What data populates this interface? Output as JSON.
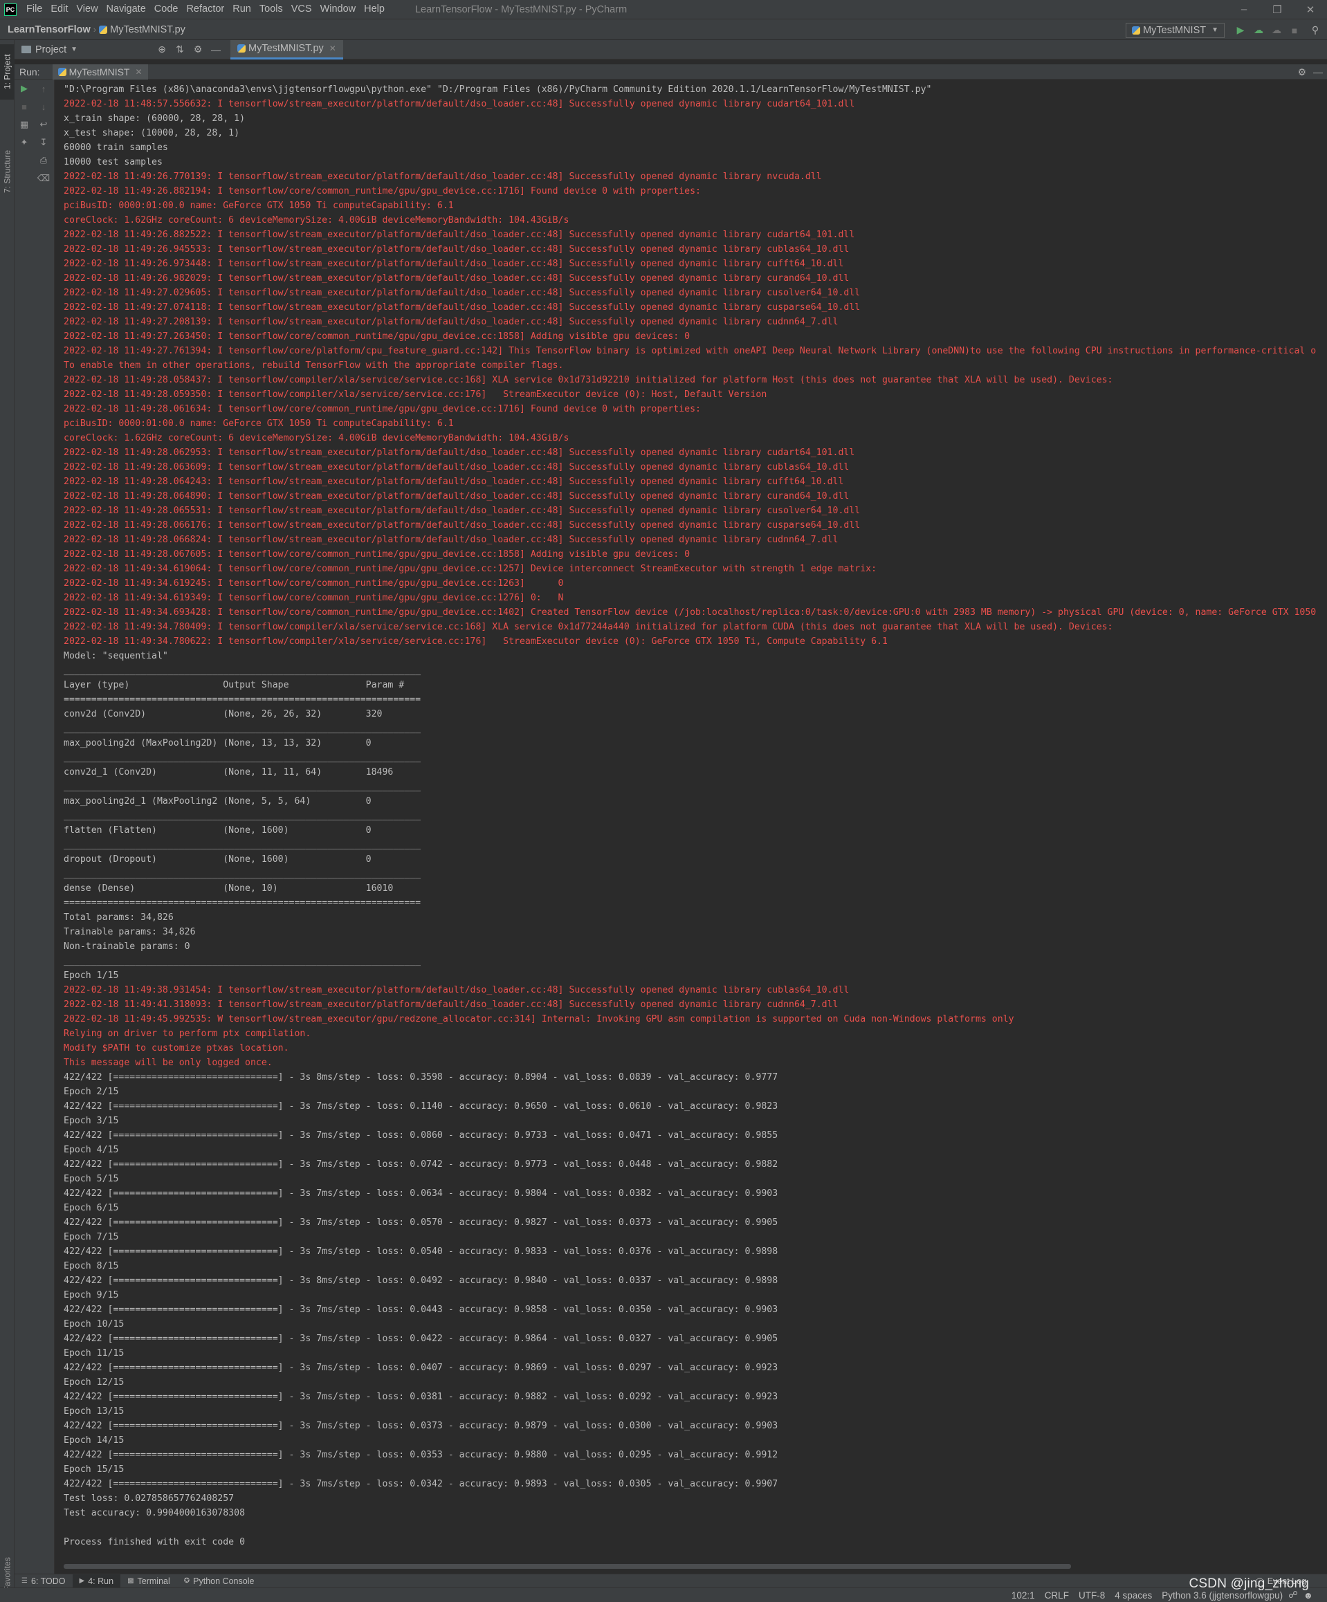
{
  "menubar": {
    "items": [
      "File",
      "Edit",
      "View",
      "Navigate",
      "Code",
      "Refactor",
      "Run",
      "Tools",
      "VCS",
      "Window",
      "Help"
    ],
    "window_title": "LearnTensorFlow - MyTestMNIST.py - PyCharm"
  },
  "navbar": {
    "project": "LearnTensorFlow",
    "file": "MyTestMNIST.py",
    "run_config": "MyTestMNIST"
  },
  "left_stripe": {
    "project_tab": "1: Project",
    "structure_tab": "7: Structure",
    "favorites_tab": "2: Favorites"
  },
  "tool_header": {
    "project_label": "Project",
    "editor_tab": "MyTestMNIST.py"
  },
  "run_window": {
    "label": "Run:",
    "tab": "MyTestMNIST"
  },
  "console": {
    "lines": [
      {
        "t": "\"D:\\Program Files (x86)\\anaconda3\\envs\\jjgtensorflowgpu\\python.exe\" \"D:/Program Files (x86)/PyCharm Community Edition 2020.1.1/LearnTensorFlow/MyTestMNIST.py\"",
        "c": "out"
      },
      {
        "t": "2022-02-18 11:48:57.556632: I tensorflow/stream_executor/platform/default/dso_loader.cc:48] Successfully opened dynamic library cudart64_101.dll",
        "c": "err"
      },
      {
        "t": "x_train shape: (60000, 28, 28, 1)",
        "c": "out"
      },
      {
        "t": "x_test shape: (10000, 28, 28, 1)",
        "c": "out"
      },
      {
        "t": "60000 train samples",
        "c": "out"
      },
      {
        "t": "10000 test samples",
        "c": "out"
      },
      {
        "t": "2022-02-18 11:49:26.770139: I tensorflow/stream_executor/platform/default/dso_loader.cc:48] Successfully opened dynamic library nvcuda.dll",
        "c": "err"
      },
      {
        "t": "2022-02-18 11:49:26.882194: I tensorflow/core/common_runtime/gpu/gpu_device.cc:1716] Found device 0 with properties:",
        "c": "err"
      },
      {
        "t": "pciBusID: 0000:01:00.0 name: GeForce GTX 1050 Ti computeCapability: 6.1",
        "c": "err"
      },
      {
        "t": "coreClock: 1.62GHz coreCount: 6 deviceMemorySize: 4.00GiB deviceMemoryBandwidth: 104.43GiB/s",
        "c": "err"
      },
      {
        "t": "2022-02-18 11:49:26.882522: I tensorflow/stream_executor/platform/default/dso_loader.cc:48] Successfully opened dynamic library cudart64_101.dll",
        "c": "err"
      },
      {
        "t": "2022-02-18 11:49:26.945533: I tensorflow/stream_executor/platform/default/dso_loader.cc:48] Successfully opened dynamic library cublas64_10.dll",
        "c": "err"
      },
      {
        "t": "2022-02-18 11:49:26.973448: I tensorflow/stream_executor/platform/default/dso_loader.cc:48] Successfully opened dynamic library cufft64_10.dll",
        "c": "err"
      },
      {
        "t": "2022-02-18 11:49:26.982029: I tensorflow/stream_executor/platform/default/dso_loader.cc:48] Successfully opened dynamic library curand64_10.dll",
        "c": "err"
      },
      {
        "t": "2022-02-18 11:49:27.029605: I tensorflow/stream_executor/platform/default/dso_loader.cc:48] Successfully opened dynamic library cusolver64_10.dll",
        "c": "err"
      },
      {
        "t": "2022-02-18 11:49:27.074118: I tensorflow/stream_executor/platform/default/dso_loader.cc:48] Successfully opened dynamic library cusparse64_10.dll",
        "c": "err"
      },
      {
        "t": "2022-02-18 11:49:27.208139: I tensorflow/stream_executor/platform/default/dso_loader.cc:48] Successfully opened dynamic library cudnn64_7.dll",
        "c": "err"
      },
      {
        "t": "2022-02-18 11:49:27.263450: I tensorflow/core/common_runtime/gpu/gpu_device.cc:1858] Adding visible gpu devices: 0",
        "c": "err"
      },
      {
        "t": "2022-02-18 11:49:27.761394: I tensorflow/core/platform/cpu_feature_guard.cc:142] This TensorFlow binary is optimized with oneAPI Deep Neural Network Library (oneDNN)to use the following CPU instructions in performance-critical o",
        "c": "err"
      },
      {
        "t": "To enable them in other operations, rebuild TensorFlow with the appropriate compiler flags.",
        "c": "err"
      },
      {
        "t": "2022-02-18 11:49:28.058437: I tensorflow/compiler/xla/service/service.cc:168] XLA service 0x1d731d92210 initialized for platform Host (this does not guarantee that XLA will be used). Devices:",
        "c": "err"
      },
      {
        "t": "2022-02-18 11:49:28.059350: I tensorflow/compiler/xla/service/service.cc:176]   StreamExecutor device (0): Host, Default Version",
        "c": "err"
      },
      {
        "t": "2022-02-18 11:49:28.061634: I tensorflow/core/common_runtime/gpu/gpu_device.cc:1716] Found device 0 with properties:",
        "c": "err"
      },
      {
        "t": "pciBusID: 0000:01:00.0 name: GeForce GTX 1050 Ti computeCapability: 6.1",
        "c": "err"
      },
      {
        "t": "coreClock: 1.62GHz coreCount: 6 deviceMemorySize: 4.00GiB deviceMemoryBandwidth: 104.43GiB/s",
        "c": "err"
      },
      {
        "t": "2022-02-18 11:49:28.062953: I tensorflow/stream_executor/platform/default/dso_loader.cc:48] Successfully opened dynamic library cudart64_101.dll",
        "c": "err"
      },
      {
        "t": "2022-02-18 11:49:28.063609: I tensorflow/stream_executor/platform/default/dso_loader.cc:48] Successfully opened dynamic library cublas64_10.dll",
        "c": "err"
      },
      {
        "t": "2022-02-18 11:49:28.064243: I tensorflow/stream_executor/platform/default/dso_loader.cc:48] Successfully opened dynamic library cufft64_10.dll",
        "c": "err"
      },
      {
        "t": "2022-02-18 11:49:28.064890: I tensorflow/stream_executor/platform/default/dso_loader.cc:48] Successfully opened dynamic library curand64_10.dll",
        "c": "err"
      },
      {
        "t": "2022-02-18 11:49:28.065531: I tensorflow/stream_executor/platform/default/dso_loader.cc:48] Successfully opened dynamic library cusolver64_10.dll",
        "c": "err"
      },
      {
        "t": "2022-02-18 11:49:28.066176: I tensorflow/stream_executor/platform/default/dso_loader.cc:48] Successfully opened dynamic library cusparse64_10.dll",
        "c": "err"
      },
      {
        "t": "2022-02-18 11:49:28.066824: I tensorflow/stream_executor/platform/default/dso_loader.cc:48] Successfully opened dynamic library cudnn64_7.dll",
        "c": "err"
      },
      {
        "t": "2022-02-18 11:49:28.067605: I tensorflow/core/common_runtime/gpu/gpu_device.cc:1858] Adding visible gpu devices: 0",
        "c": "err"
      },
      {
        "t": "2022-02-18 11:49:34.619064: I tensorflow/core/common_runtime/gpu/gpu_device.cc:1257] Device interconnect StreamExecutor with strength 1 edge matrix:",
        "c": "err"
      },
      {
        "t": "2022-02-18 11:49:34.619245: I tensorflow/core/common_runtime/gpu/gpu_device.cc:1263]      0",
        "c": "err"
      },
      {
        "t": "2022-02-18 11:49:34.619349: I tensorflow/core/common_runtime/gpu/gpu_device.cc:1276] 0:   N",
        "c": "err"
      },
      {
        "t": "2022-02-18 11:49:34.693428: I tensorflow/core/common_runtime/gpu/gpu_device.cc:1402] Created TensorFlow device (/job:localhost/replica:0/task:0/device:GPU:0 with 2983 MB memory) -> physical GPU (device: 0, name: GeForce GTX 1050",
        "c": "err"
      },
      {
        "t": "2022-02-18 11:49:34.780409: I tensorflow/compiler/xla/service/service.cc:168] XLA service 0x1d77244a440 initialized for platform CUDA (this does not guarantee that XLA will be used). Devices:",
        "c": "err"
      },
      {
        "t": "2022-02-18 11:49:34.780622: I tensorflow/compiler/xla/service/service.cc:176]   StreamExecutor device (0): GeForce GTX 1050 Ti, Compute Capability 6.1",
        "c": "err"
      },
      {
        "t": "Model: \"sequential\"",
        "c": "out"
      },
      {
        "t": "_________________________________________________________________",
        "c": "out"
      },
      {
        "t": "Layer (type)                 Output Shape              Param #",
        "c": "out"
      },
      {
        "t": "=================================================================",
        "c": "out"
      },
      {
        "t": "conv2d (Conv2D)              (None, 26, 26, 32)        320",
        "c": "out"
      },
      {
        "t": "_________________________________________________________________",
        "c": "out"
      },
      {
        "t": "max_pooling2d (MaxPooling2D) (None, 13, 13, 32)        0",
        "c": "out"
      },
      {
        "t": "_________________________________________________________________",
        "c": "out"
      },
      {
        "t": "conv2d_1 (Conv2D)            (None, 11, 11, 64)        18496",
        "c": "out"
      },
      {
        "t": "_________________________________________________________________",
        "c": "out"
      },
      {
        "t": "max_pooling2d_1 (MaxPooling2 (None, 5, 5, 64)          0",
        "c": "out"
      },
      {
        "t": "_________________________________________________________________",
        "c": "out"
      },
      {
        "t": "flatten (Flatten)            (None, 1600)              0",
        "c": "out"
      },
      {
        "t": "_________________________________________________________________",
        "c": "out"
      },
      {
        "t": "dropout (Dropout)            (None, 1600)              0",
        "c": "out"
      },
      {
        "t": "_________________________________________________________________",
        "c": "out"
      },
      {
        "t": "dense (Dense)                (None, 10)                16010",
        "c": "out"
      },
      {
        "t": "=================================================================",
        "c": "out"
      },
      {
        "t": "Total params: 34,826",
        "c": "out"
      },
      {
        "t": "Trainable params: 34,826",
        "c": "out"
      },
      {
        "t": "Non-trainable params: 0",
        "c": "out"
      },
      {
        "t": "_________________________________________________________________",
        "c": "out"
      },
      {
        "t": "Epoch 1/15",
        "c": "out"
      },
      {
        "t": "2022-02-18 11:49:38.931454: I tensorflow/stream_executor/platform/default/dso_loader.cc:48] Successfully opened dynamic library cublas64_10.dll",
        "c": "err"
      },
      {
        "t": "2022-02-18 11:49:41.318093: I tensorflow/stream_executor/platform/default/dso_loader.cc:48] Successfully opened dynamic library cudnn64_7.dll",
        "c": "err"
      },
      {
        "t": "2022-02-18 11:49:45.992535: W tensorflow/stream_executor/gpu/redzone_allocator.cc:314] Internal: Invoking GPU asm compilation is supported on Cuda non-Windows platforms only",
        "c": "err"
      },
      {
        "t": "Relying on driver to perform ptx compilation.",
        "c": "err"
      },
      {
        "t": "Modify $PATH to customize ptxas location.",
        "c": "err"
      },
      {
        "t": "This message will be only logged once.",
        "c": "err"
      },
      {
        "t": "422/422 [==============================] - 3s 8ms/step - loss: 0.3598 - accuracy: 0.8904 - val_loss: 0.0839 - val_accuracy: 0.9777",
        "c": "out"
      },
      {
        "t": "Epoch 2/15",
        "c": "out"
      },
      {
        "t": "422/422 [==============================] - 3s 7ms/step - loss: 0.1140 - accuracy: 0.9650 - val_loss: 0.0610 - val_accuracy: 0.9823",
        "c": "out"
      },
      {
        "t": "Epoch 3/15",
        "c": "out"
      },
      {
        "t": "422/422 [==============================] - 3s 7ms/step - loss: 0.0860 - accuracy: 0.9733 - val_loss: 0.0471 - val_accuracy: 0.9855",
        "c": "out"
      },
      {
        "t": "Epoch 4/15",
        "c": "out"
      },
      {
        "t": "422/422 [==============================] - 3s 7ms/step - loss: 0.0742 - accuracy: 0.9773 - val_loss: 0.0448 - val_accuracy: 0.9882",
        "c": "out"
      },
      {
        "t": "Epoch 5/15",
        "c": "out"
      },
      {
        "t": "422/422 [==============================] - 3s 7ms/step - loss: 0.0634 - accuracy: 0.9804 - val_loss: 0.0382 - val_accuracy: 0.9903",
        "c": "out"
      },
      {
        "t": "Epoch 6/15",
        "c": "out"
      },
      {
        "t": "422/422 [==============================] - 3s 7ms/step - loss: 0.0570 - accuracy: 0.9827 - val_loss: 0.0373 - val_accuracy: 0.9905",
        "c": "out"
      },
      {
        "t": "Epoch 7/15",
        "c": "out"
      },
      {
        "t": "422/422 [==============================] - 3s 7ms/step - loss: 0.0540 - accuracy: 0.9833 - val_loss: 0.0376 - val_accuracy: 0.9898",
        "c": "out"
      },
      {
        "t": "Epoch 8/15",
        "c": "out"
      },
      {
        "t": "422/422 [==============================] - 3s 8ms/step - loss: 0.0492 - accuracy: 0.9840 - val_loss: 0.0337 - val_accuracy: 0.9898",
        "c": "out"
      },
      {
        "t": "Epoch 9/15",
        "c": "out"
      },
      {
        "t": "422/422 [==============================] - 3s 7ms/step - loss: 0.0443 - accuracy: 0.9858 - val_loss: 0.0350 - val_accuracy: 0.9903",
        "c": "out"
      },
      {
        "t": "Epoch 10/15",
        "c": "out"
      },
      {
        "t": "422/422 [==============================] - 3s 7ms/step - loss: 0.0422 - accuracy: 0.9864 - val_loss: 0.0327 - val_accuracy: 0.9905",
        "c": "out"
      },
      {
        "t": "Epoch 11/15",
        "c": "out"
      },
      {
        "t": "422/422 [==============================] - 3s 7ms/step - loss: 0.0407 - accuracy: 0.9869 - val_loss: 0.0297 - val_accuracy: 0.9923",
        "c": "out"
      },
      {
        "t": "Epoch 12/15",
        "c": "out"
      },
      {
        "t": "422/422 [==============================] - 3s 7ms/step - loss: 0.0381 - accuracy: 0.9882 - val_loss: 0.0292 - val_accuracy: 0.9923",
        "c": "out"
      },
      {
        "t": "Epoch 13/15",
        "c": "out"
      },
      {
        "t": "422/422 [==============================] - 3s 7ms/step - loss: 0.0373 - accuracy: 0.9879 - val_loss: 0.0300 - val_accuracy: 0.9903",
        "c": "out"
      },
      {
        "t": "Epoch 14/15",
        "c": "out"
      },
      {
        "t": "422/422 [==============================] - 3s 7ms/step - loss: 0.0353 - accuracy: 0.9880 - val_loss: 0.0295 - val_accuracy: 0.9912",
        "c": "out"
      },
      {
        "t": "Epoch 15/15",
        "c": "out"
      },
      {
        "t": "422/422 [==============================] - 3s 7ms/step - loss: 0.0342 - accuracy: 0.9893 - val_loss: 0.0305 - val_accuracy: 0.9907",
        "c": "out"
      },
      {
        "t": "Test loss: 0.027858657762408257",
        "c": "out"
      },
      {
        "t": "Test accuracy: 0.9904000163078308",
        "c": "out"
      },
      {
        "t": "",
        "c": "out"
      },
      {
        "t": "Process finished with exit code 0",
        "c": "out"
      }
    ]
  },
  "bottom_bar": {
    "todo": "6: TODO",
    "run": "4: Run",
    "terminal": "Terminal",
    "python_console": "Python Console",
    "event_log": "Event Log"
  },
  "status_bar": {
    "position": "102:1",
    "line_separator": "CRLF",
    "encoding": "UTF-8",
    "indent": "4 spaces",
    "interpreter": "Python 3.6 (jjgtensorflowgpu)"
  },
  "watermark": "CSDN @jing_zhong",
  "colors": {
    "background": "#2b2b2b",
    "panel": "#3c3f41",
    "stdout": "#bbbbbb",
    "stderr": "#e8504c",
    "run_green": "#59a869",
    "accent_blue": "#4a88c7"
  }
}
